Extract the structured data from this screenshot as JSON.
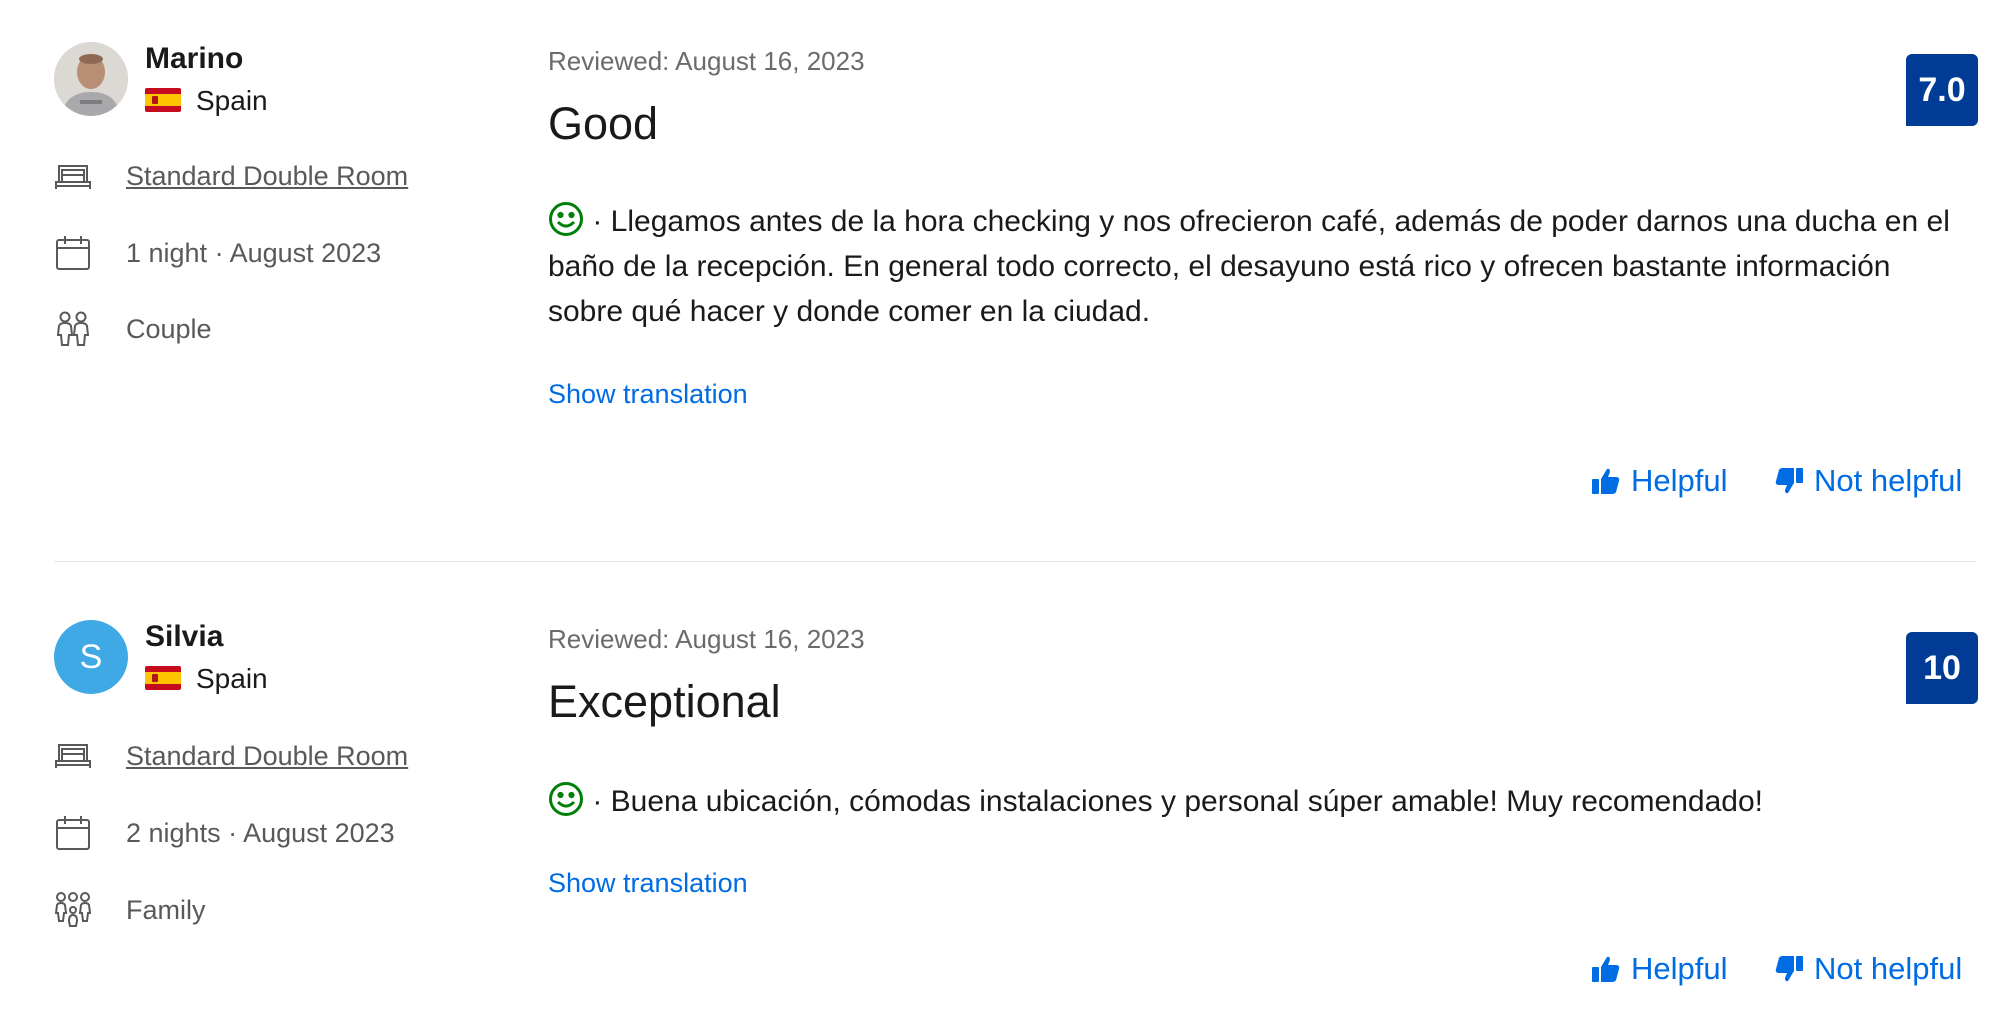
{
  "reviews": [
    {
      "reviewer_name": "Marino",
      "country": "Spain",
      "avatar_type": "photo",
      "room": "Standard Double Room",
      "stay": "1 night · August 2023",
      "traveler_type": "Couple",
      "reviewed_date": "Reviewed: August 16, 2023",
      "title": "Good",
      "score": "7.0",
      "body": " · Llegamos antes de la hora checking y nos ofrecieron café, además de poder darnos una ducha en el baño de la recepción. En general todo correcto, el desayuno está rico y ofrecen bastante información sobre qué hacer y donde comer en la ciudad.",
      "show_translation": "Show translation",
      "helpful_label": "Helpful",
      "not_helpful_label": "Not helpful"
    },
    {
      "reviewer_name": "Silvia",
      "country": "Spain",
      "avatar_type": "letter",
      "avatar_letter": "S",
      "room": "Standard Double Room",
      "stay": "2 nights · August 2023",
      "traveler_type": "Family",
      "reviewed_date": "Reviewed: August 16, 2023",
      "title": "Exceptional",
      "score": "10",
      "body": " · Buena ubicación, cómodas instalaciones y personal súper amable! Muy recomendado!",
      "show_translation": "Show translation",
      "helpful_label": "Helpful",
      "not_helpful_label": "Not helpful"
    }
  ],
  "icons": {
    "room": "bed-icon",
    "stay": "calendar-icon",
    "traveler_couple": "couple-icon",
    "traveler_family": "family-icon",
    "sentiment": "smiley-icon",
    "helpful": "thumbs-up-icon",
    "not_helpful": "thumbs-down-icon"
  },
  "colors": {
    "score_badge": "#003b95",
    "link": "#006ce4",
    "smiley": "#008009",
    "letter_avatar": "#3fa9e5"
  }
}
